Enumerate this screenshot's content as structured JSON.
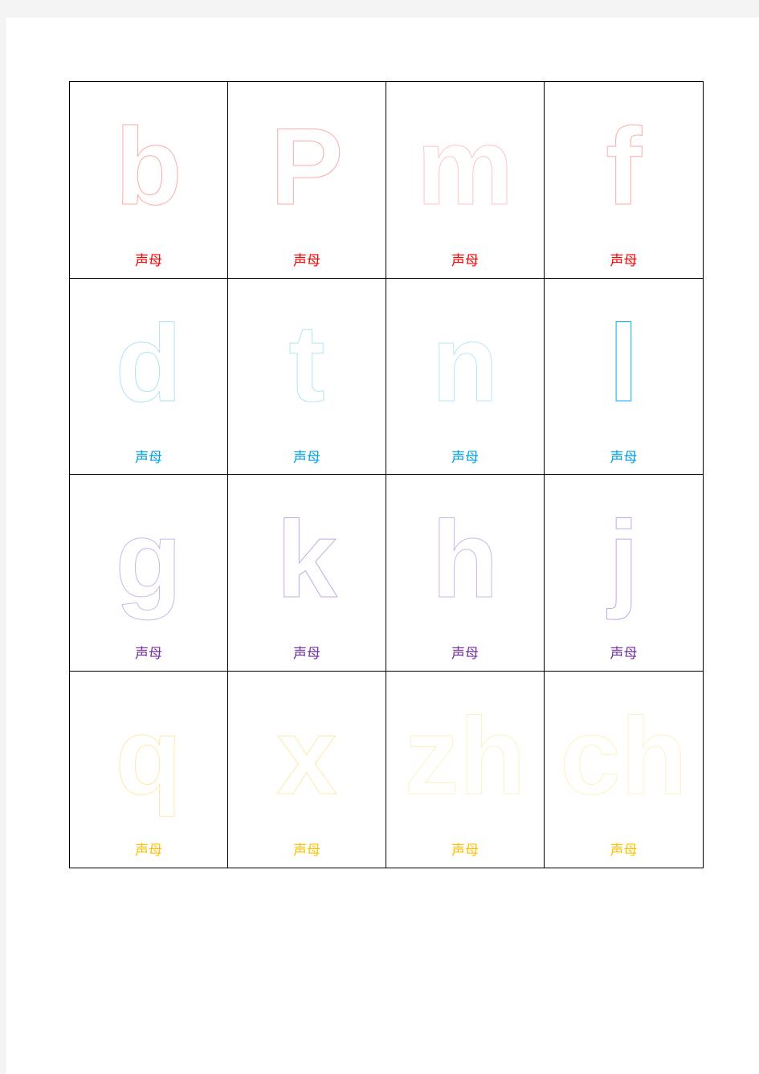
{
  "cards": [
    {
      "letter": "b",
      "label": "声母",
      "stroke": "#ffaaaa",
      "color": "#ff0000"
    },
    {
      "letter": "P",
      "label": "声母",
      "stroke": "#ffaaaa",
      "color": "#ff0000"
    },
    {
      "letter": "m",
      "label": "声母",
      "stroke": "#ffc4c4",
      "color": "#ff0000"
    },
    {
      "letter": "f",
      "label": "声母",
      "stroke": "#ffaaaa",
      "color": "#ff0000"
    },
    {
      "letter": "d",
      "label": "声母",
      "stroke": "#b0e2f6",
      "color": "#00a0e9"
    },
    {
      "letter": "t",
      "label": "声母",
      "stroke": "#b0e2f6",
      "color": "#00a0e9"
    },
    {
      "letter": "n",
      "label": "声母",
      "stroke": "#b8e6f8",
      "color": "#00a0e9"
    },
    {
      "letter": "l",
      "label": "声母",
      "stroke": "#00b0f0",
      "color": "#00a0e9"
    },
    {
      "letter": "g",
      "label": "声母",
      "stroke": "#cdb6e6",
      "color": "#7030a0"
    },
    {
      "letter": "k",
      "label": "声母",
      "stroke": "#c4a8e2",
      "color": "#7030a0"
    },
    {
      "letter": "h",
      "label": "声母",
      "stroke": "#cdb6e6",
      "color": "#7030a0"
    },
    {
      "letter": "j",
      "label": "声母",
      "stroke": "#c4a8e2",
      "color": "#7030a0"
    },
    {
      "letter": "q",
      "label": "声母",
      "stroke": "#ffe8a8",
      "color": "#ffc000"
    },
    {
      "letter": "x",
      "label": "声母",
      "stroke": "#ffe8a8",
      "color": "#ffc000"
    },
    {
      "letter": "zh",
      "label": "声母",
      "stroke": "#fff0c0",
      "color": "#ffc000"
    },
    {
      "letter": "ch",
      "label": "声母",
      "stroke": "#fff0c0",
      "color": "#ffc000"
    }
  ]
}
